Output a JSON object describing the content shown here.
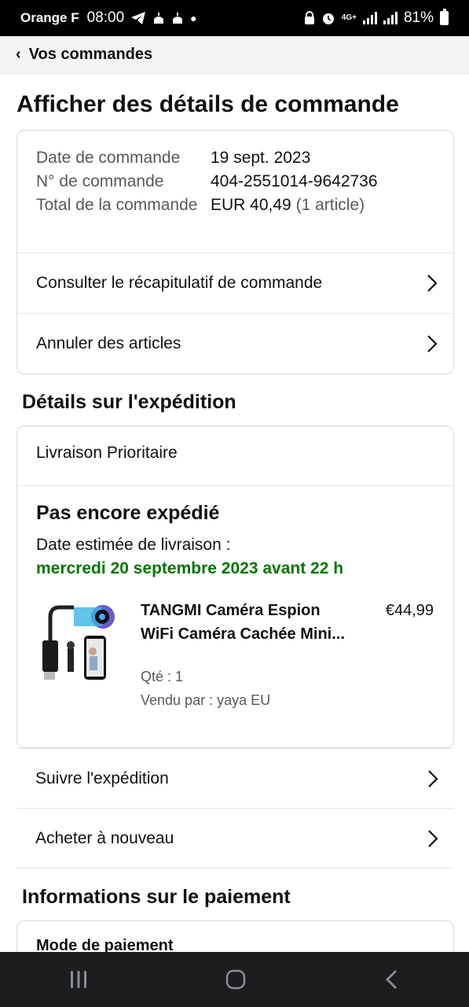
{
  "status_bar": {
    "carrier": "Orange F",
    "time": "08:00",
    "battery": "81%",
    "network": "4G+"
  },
  "nav": {
    "back_label": "Vos commandes"
  },
  "page_title": "Afficher des détails de commande",
  "order": {
    "date_label": "Date de commande",
    "date_value": "19 sept. 2023",
    "number_label": "N° de commande",
    "number_value": "404-2551014-9642736",
    "total_label": "Total de la commande",
    "total_value": "EUR 40,49",
    "total_count": "(1 article)",
    "summary_link": "Consulter le récapitulatif de commande",
    "cancel_link": "Annuler des articles"
  },
  "shipping": {
    "section_title": "Détails sur l'expédition",
    "method": "Livraison Prioritaire",
    "status": "Pas encore expédié",
    "estimate_label": "Date estimée de livraison :",
    "estimate_date": "mercredi 20 septembre 2023 avant 22 h",
    "product": {
      "title": "TANGMI Caméra Espion WiFi Caméra Cachée Mini...",
      "price": "€44,99",
      "qty": "Qté : 1",
      "seller": "Vendu par : yaya EU"
    },
    "track_link": "Suivre l'expédition",
    "buy_again_link": "Acheter à nouveau"
  },
  "payment": {
    "section_title": "Informations sur le paiement",
    "method_label": "Mode de paiement"
  },
  "colors": {
    "accent_green": "#007600",
    "text": "#0f1111",
    "muted": "#565959"
  }
}
